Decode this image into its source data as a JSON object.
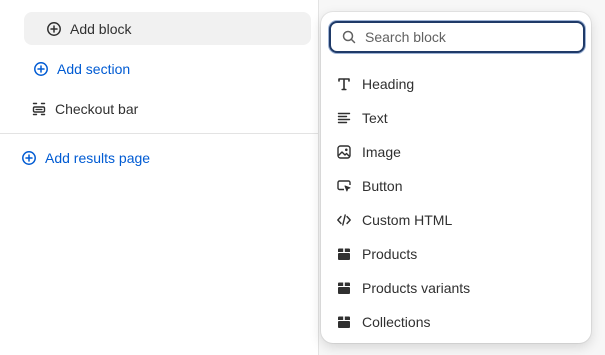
{
  "left": {
    "add_block": {
      "label": "Add block",
      "icon": "plus-circle-icon"
    },
    "add_section": {
      "label": "Add section",
      "icon": "plus-circle-icon"
    },
    "checkout_bar": {
      "label": "Checkout bar",
      "icon": "checkout-bar-icon"
    },
    "add_results_page": {
      "label": "Add results page",
      "icon": "plus-circle-icon"
    }
  },
  "popover": {
    "search": {
      "placeholder": "Search block",
      "value": ""
    },
    "items": [
      {
        "label": "Heading",
        "icon": "heading-icon"
      },
      {
        "label": "Text",
        "icon": "text-icon"
      },
      {
        "label": "Image",
        "icon": "image-icon"
      },
      {
        "label": "Button",
        "icon": "button-icon"
      },
      {
        "label": "Custom HTML",
        "icon": "code-icon"
      },
      {
        "label": "Products",
        "icon": "product-icon"
      },
      {
        "label": "Products variants",
        "icon": "product-icon"
      },
      {
        "label": "Collections",
        "icon": "product-icon"
      }
    ]
  },
  "colors": {
    "accent": "#005bd3",
    "focus_ring": "#1f3a68",
    "text": "#303030"
  }
}
